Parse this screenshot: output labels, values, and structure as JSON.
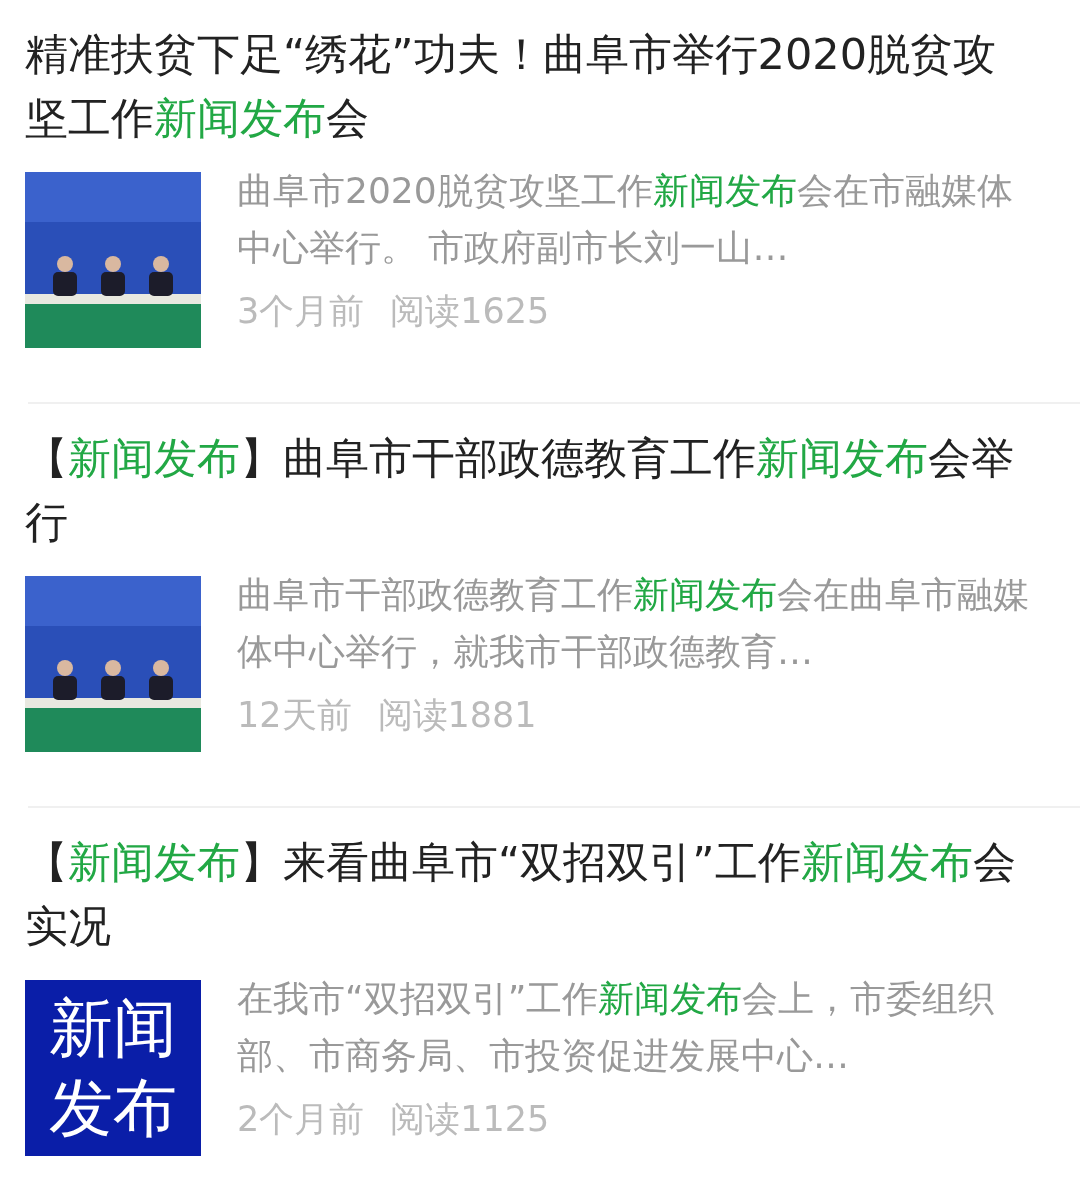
{
  "results": [
    {
      "title": [
        {
          "text": "精准扶贫下足“绣花”功夫！曲阜市举行2020脱贫攻坚工作",
          "highlight": false
        },
        {
          "text": "新闻发布",
          "highlight": true
        },
        {
          "text": "会",
          "highlight": false
        }
      ],
      "snippet": [
        {
          "text": "曲阜市2020脱贫攻坚工作",
          "highlight": false
        },
        {
          "text": "新闻发布",
          "highlight": true
        },
        {
          "text": "会在市融媒体中心举行。 市政府副市长刘一山…",
          "highlight": false
        }
      ],
      "time": "3个月前",
      "reads": "阅读1625"
    },
    {
      "title": [
        {
          "text": "【",
          "highlight": false
        },
        {
          "text": "新闻发布",
          "highlight": true
        },
        {
          "text": "】曲阜市干部政德教育工作",
          "highlight": false
        },
        {
          "text": "新闻发布",
          "highlight": true
        },
        {
          "text": "会举行",
          "highlight": false
        }
      ],
      "snippet": [
        {
          "text": "曲阜市干部政德教育工作",
          "highlight": false
        },
        {
          "text": "新闻发布",
          "highlight": true
        },
        {
          "text": "会在曲阜市融媒体中心举行，就我市干部政德教育…",
          "highlight": false
        }
      ],
      "time": "12天前",
      "reads": "阅读1881"
    },
    {
      "title": [
        {
          "text": "【",
          "highlight": false
        },
        {
          "text": "新闻发布",
          "highlight": true
        },
        {
          "text": "】来看曲阜市“双招双引”工作",
          "highlight": false
        },
        {
          "text": "新闻发布",
          "highlight": true
        },
        {
          "text": "会实况",
          "highlight": false
        }
      ],
      "thumbnail": {
        "kind": "text",
        "lines": [
          "新闻",
          "发布"
        ]
      },
      "snippet": [
        {
          "text": "在我市“双招双引”工作",
          "highlight": false
        },
        {
          "text": "新闻发布",
          "highlight": true
        },
        {
          "text": "会上，市委组织部、市商务局、市投资促进发展中心…",
          "highlight": false
        }
      ],
      "time": "2个月前",
      "reads": "阅读1125"
    }
  ]
}
